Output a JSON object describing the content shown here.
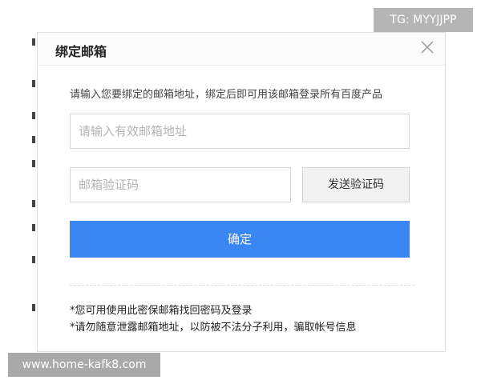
{
  "dialog": {
    "title": "绑定邮箱",
    "description": "请输入您要绑定的邮箱地址，绑定后即可用该邮箱登录所有百度产品",
    "email_input": {
      "placeholder": "请输入有效邮箱地址",
      "value": ""
    },
    "code_input": {
      "placeholder": "邮箱验证码",
      "value": ""
    },
    "send_code_label": "发送验证码",
    "confirm_label": "确定",
    "notes": [
      "*您可用使用此密保邮箱找回密码及登录",
      "*请勿随意泄露邮箱地址，以防被不法分子利用，骗取帐号信息"
    ],
    "icons": {
      "close": "close-icon"
    },
    "colors": {
      "primary": "#3a86f2",
      "border": "#d6d6d6"
    }
  },
  "overlays": {
    "tg": "TG: MYYJJPP",
    "url": "www.home-kafk8.com"
  }
}
